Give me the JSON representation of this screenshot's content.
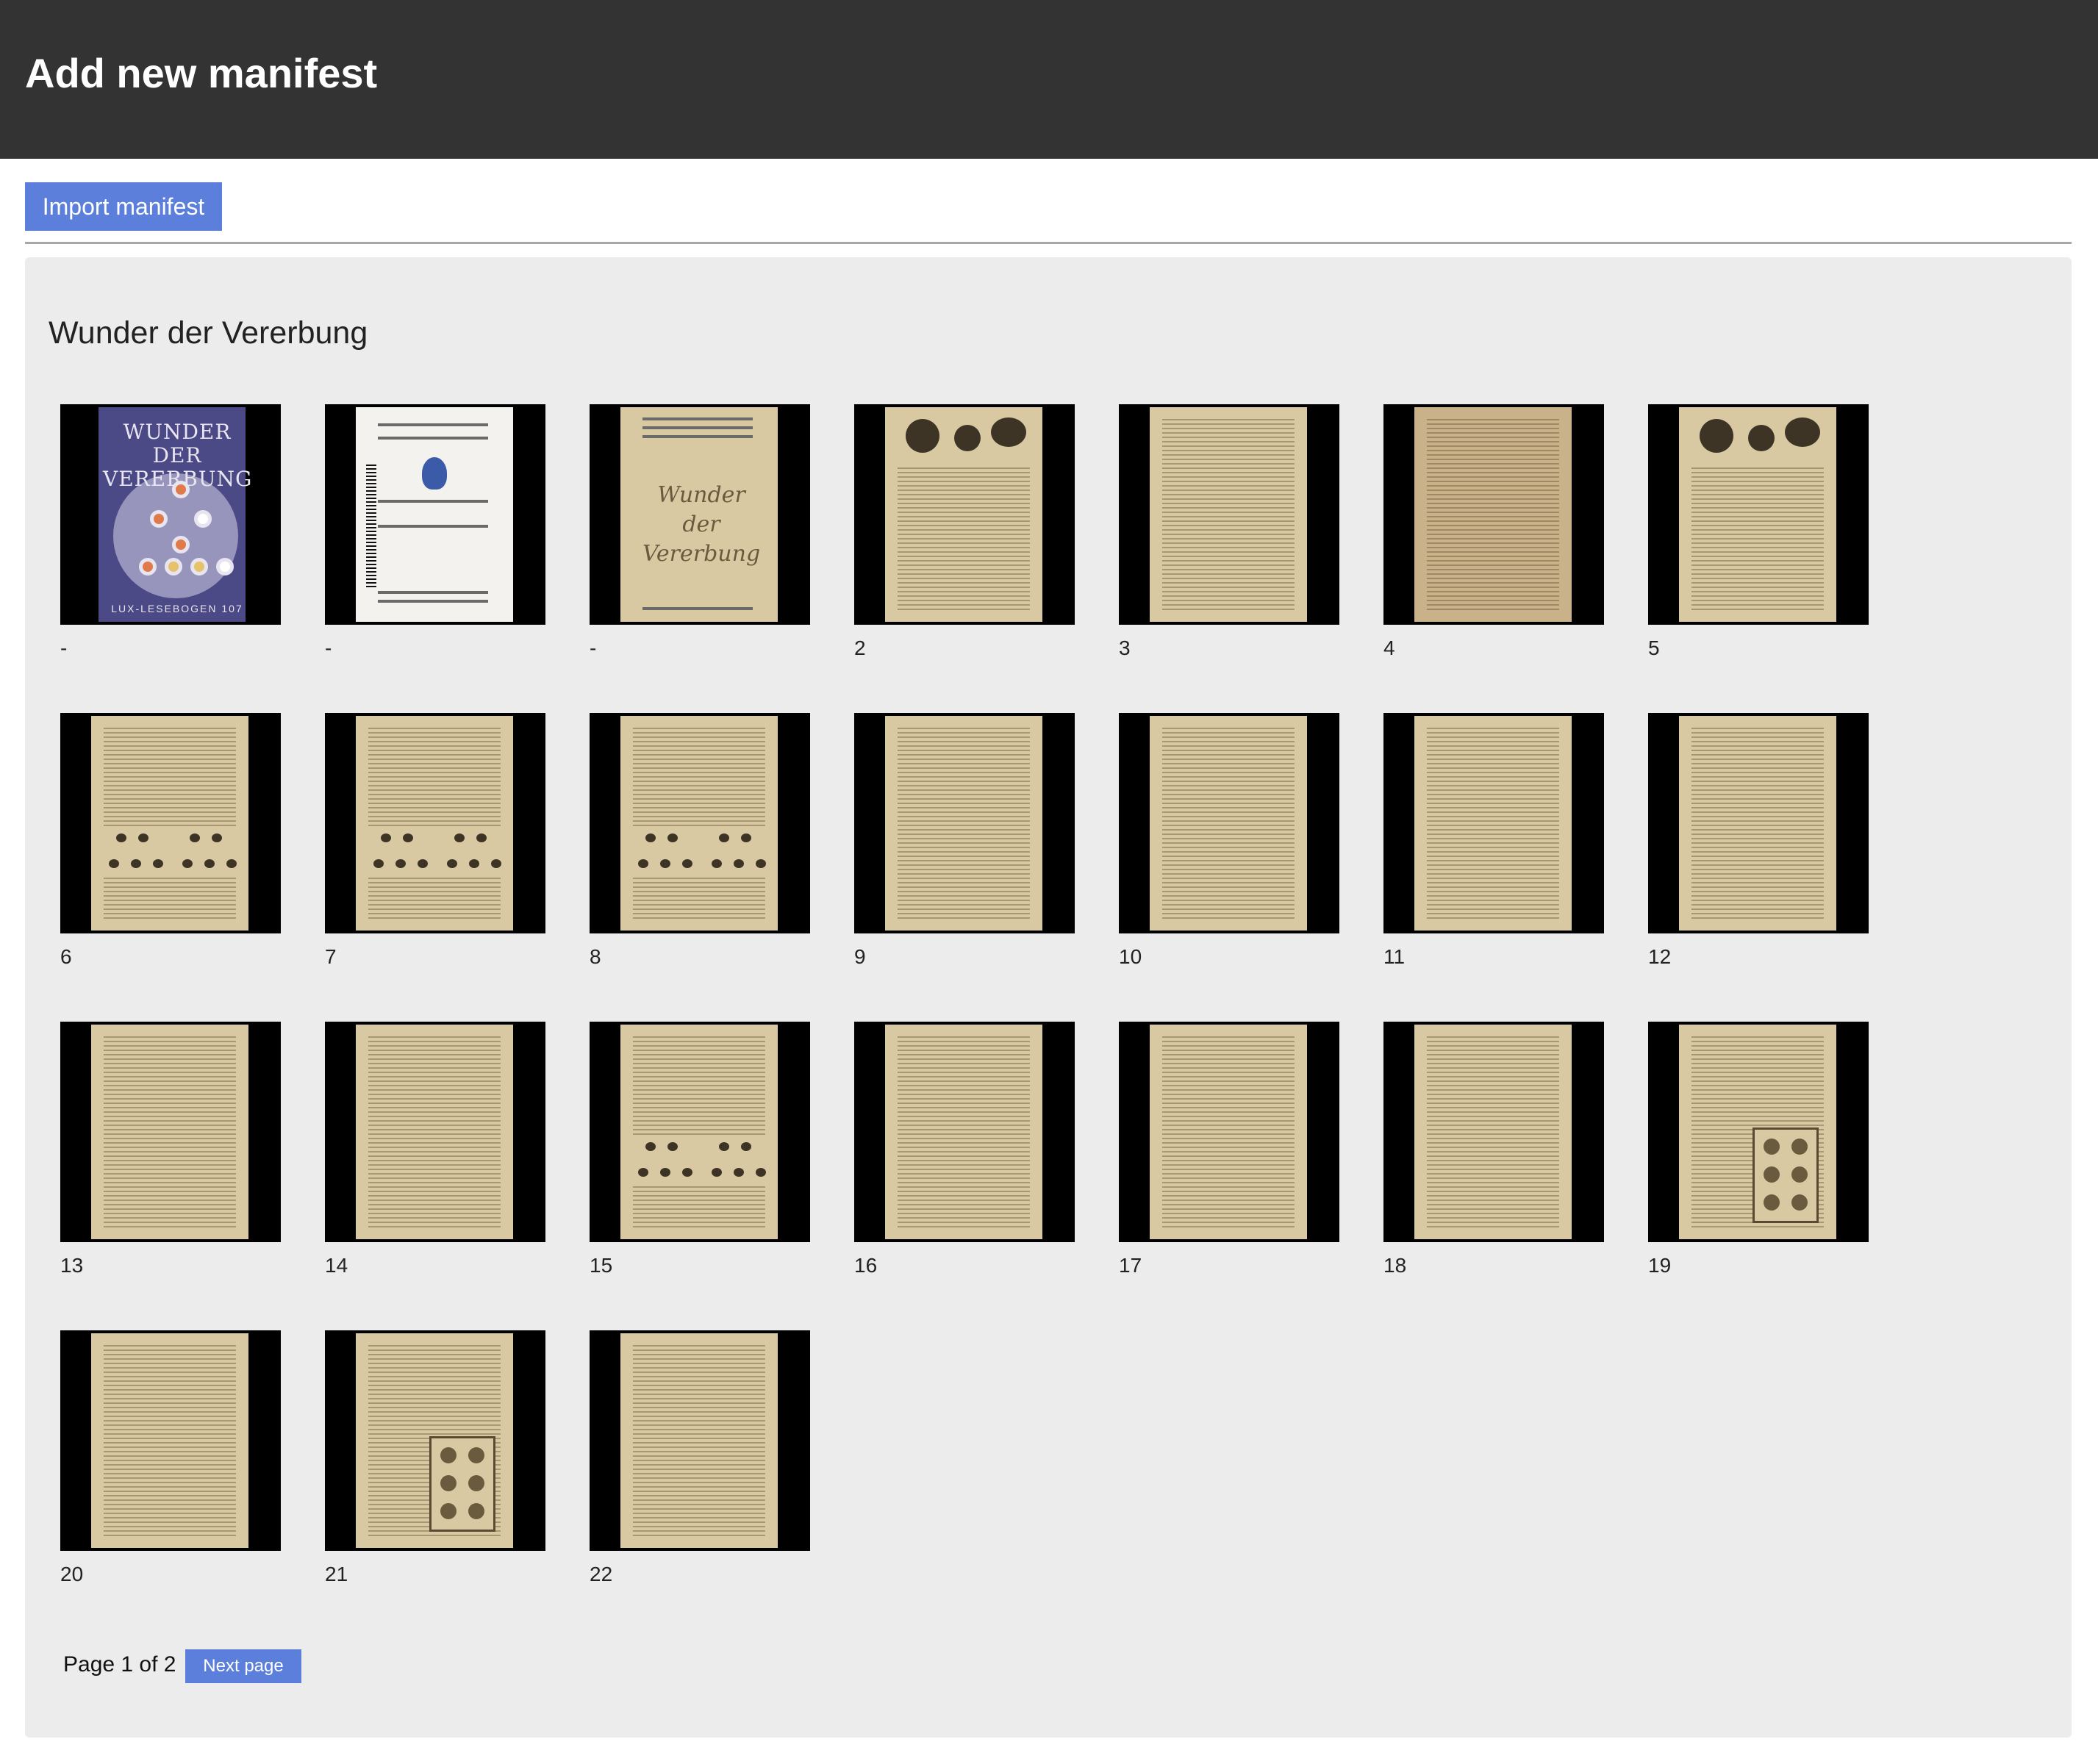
{
  "header": {
    "title": "Add new manifest"
  },
  "toolbar": {
    "import_label": "Import manifest"
  },
  "manifest": {
    "title": "Wunder der Vererbung",
    "cover_title": "WUNDER DER VERERBUNG",
    "cover_footer": "LUX-LESEBOGEN 107",
    "title_page_script": "Wunder der Vererbung",
    "pages": [
      {
        "label": "-",
        "kind": "cover"
      },
      {
        "label": "-",
        "kind": "back-cover"
      },
      {
        "label": "-",
        "kind": "title-page"
      },
      {
        "label": "2",
        "kind": "text-figure-top"
      },
      {
        "label": "3",
        "kind": "text"
      },
      {
        "label": "4",
        "kind": "text-dark"
      },
      {
        "label": "5",
        "kind": "text-figure-top"
      },
      {
        "label": "6",
        "kind": "text-diagram"
      },
      {
        "label": "7",
        "kind": "text-diagram"
      },
      {
        "label": "8",
        "kind": "text-diagram"
      },
      {
        "label": "9",
        "kind": "text"
      },
      {
        "label": "10",
        "kind": "text"
      },
      {
        "label": "11",
        "kind": "text"
      },
      {
        "label": "12",
        "kind": "text"
      },
      {
        "label": "13",
        "kind": "text"
      },
      {
        "label": "14",
        "kind": "text"
      },
      {
        "label": "15",
        "kind": "text-diagram"
      },
      {
        "label": "16",
        "kind": "text"
      },
      {
        "label": "17",
        "kind": "text"
      },
      {
        "label": "18",
        "kind": "text"
      },
      {
        "label": "19",
        "kind": "text-figure-bottom"
      },
      {
        "label": "20",
        "kind": "text"
      },
      {
        "label": "21",
        "kind": "text-figure-bottom"
      },
      {
        "label": "22",
        "kind": "text"
      }
    ]
  },
  "pagination": {
    "status": "Page 1 of 2",
    "next_label": "Next page"
  },
  "colors": {
    "header_bg": "#333333",
    "accent": "#5b7fdb",
    "panel_bg": "#ececec",
    "thumb_bg": "#000000",
    "paper": "#d9c9a3"
  }
}
